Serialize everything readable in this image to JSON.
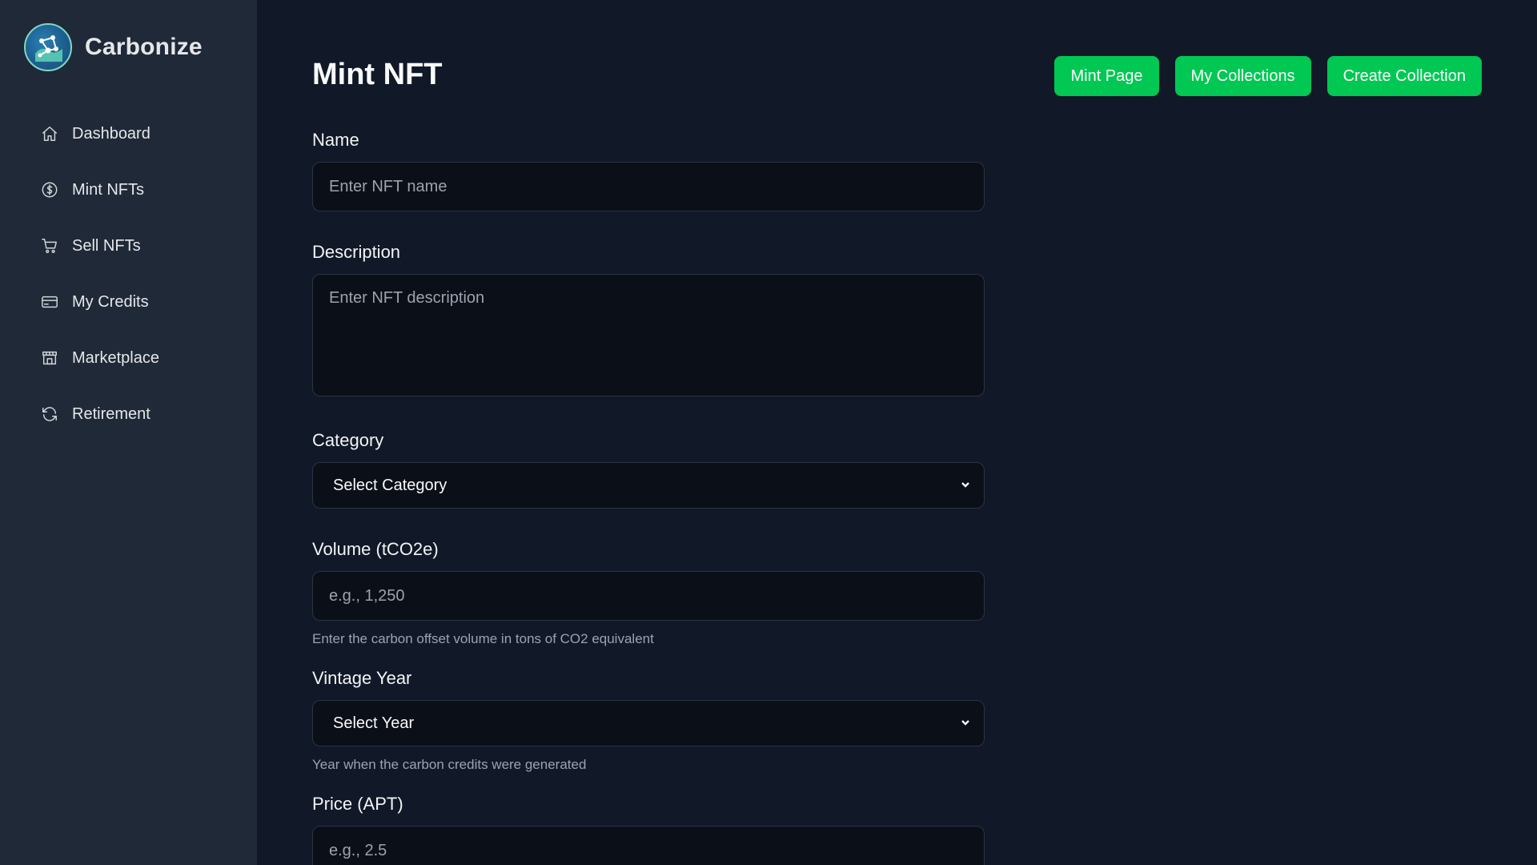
{
  "brand": {
    "name": "Carbonize",
    "logo_icon": "carbon-network-logo"
  },
  "sidebar": {
    "items": [
      {
        "label": "Dashboard",
        "icon": "home-icon"
      },
      {
        "label": "Mint NFTs",
        "icon": "dollar-circle-icon"
      },
      {
        "label": "Sell NFTs",
        "icon": "cart-icon"
      },
      {
        "label": "My Credits",
        "icon": "credit-card-icon"
      },
      {
        "label": "Marketplace",
        "icon": "store-icon"
      },
      {
        "label": "Retirement",
        "icon": "refresh-icon"
      }
    ]
  },
  "header": {
    "title": "Mint NFT",
    "actions": [
      "Mint Page",
      "My Collections",
      "Create Collection"
    ]
  },
  "form": {
    "name": {
      "label": "Name",
      "placeholder": "Enter NFT name"
    },
    "description": {
      "label": "Description",
      "placeholder": "Enter NFT description"
    },
    "category": {
      "label": "Category",
      "selected": "Select Category"
    },
    "volume": {
      "label": "Volume (tCO2e)",
      "placeholder": "e.g., 1,250",
      "hint": "Enter the carbon offset volume in tons of CO2 equivalent"
    },
    "vintage": {
      "label": "Vintage Year",
      "selected": "Select Year",
      "hint": "Year when the carbon credits were generated"
    },
    "price": {
      "label": "Price (APT)",
      "placeholder": "e.g., 2.5"
    }
  },
  "colors": {
    "background": "#111827",
    "sidebar": "#1f2937",
    "accent": "#00c853",
    "input_bg": "#0b0f17"
  }
}
